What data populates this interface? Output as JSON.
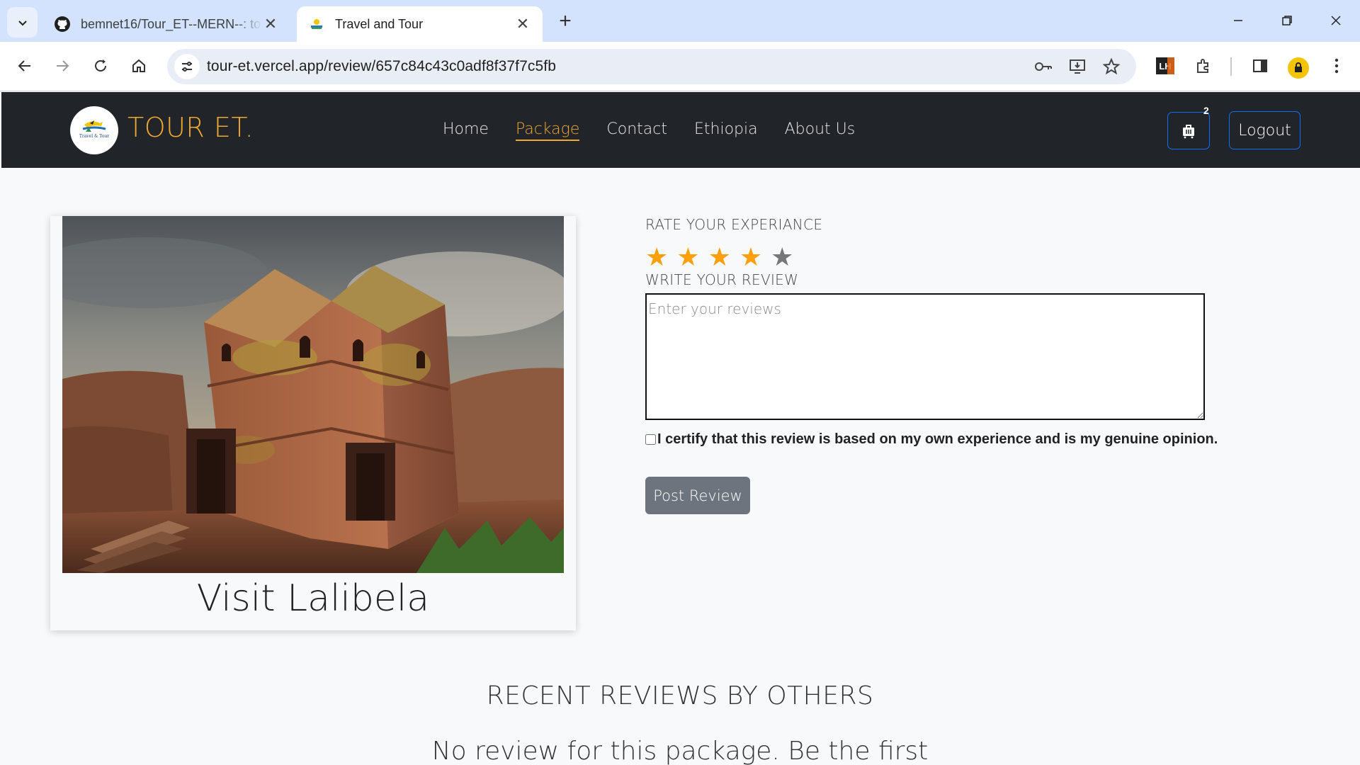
{
  "browser": {
    "tabs": [
      {
        "title": "bemnet16/Tour_ET--MERN--: to",
        "favicon": "github-icon",
        "active": false
      },
      {
        "title": "Travel and Tour",
        "favicon": "site-favicon",
        "active": true
      }
    ],
    "url": "tour-et.vercel.app/review/657c84c43c0adf8f37f7c5fb",
    "extension_label": "LH"
  },
  "site": {
    "brand": "TOUR ET.",
    "logo_text": "Travel & Tour",
    "nav": [
      "Home",
      "Package",
      "Contact",
      "Ethiopia",
      "About Us"
    ],
    "active_nav": "Package",
    "cart_count": "2",
    "logout_label": "Logout"
  },
  "package": {
    "title": "Visit Lalibela",
    "image": "rock-hewn-church-lalibela"
  },
  "review_form": {
    "rate_label": "RATE YOUR EXPERIANCE",
    "rating": 4,
    "max_rating": 5,
    "review_label": "WRITE YOUR REVIEW",
    "placeholder": "Enter your reviews",
    "certify_text": "I certify that this review is based on my own experience and is my genuine opinion.",
    "post_label": "Post Review"
  },
  "reviews": {
    "heading": "RECENT REVIEWS BY OTHERS",
    "empty_text": "No review for this package. Be the first"
  },
  "colors": {
    "accent": "#f0a830",
    "nav_bg": "#212529",
    "star_filled": "#ff9f0a",
    "star_empty": "#777777",
    "button_primary_border": "#0d6efd",
    "post_button": "#6c757d"
  }
}
